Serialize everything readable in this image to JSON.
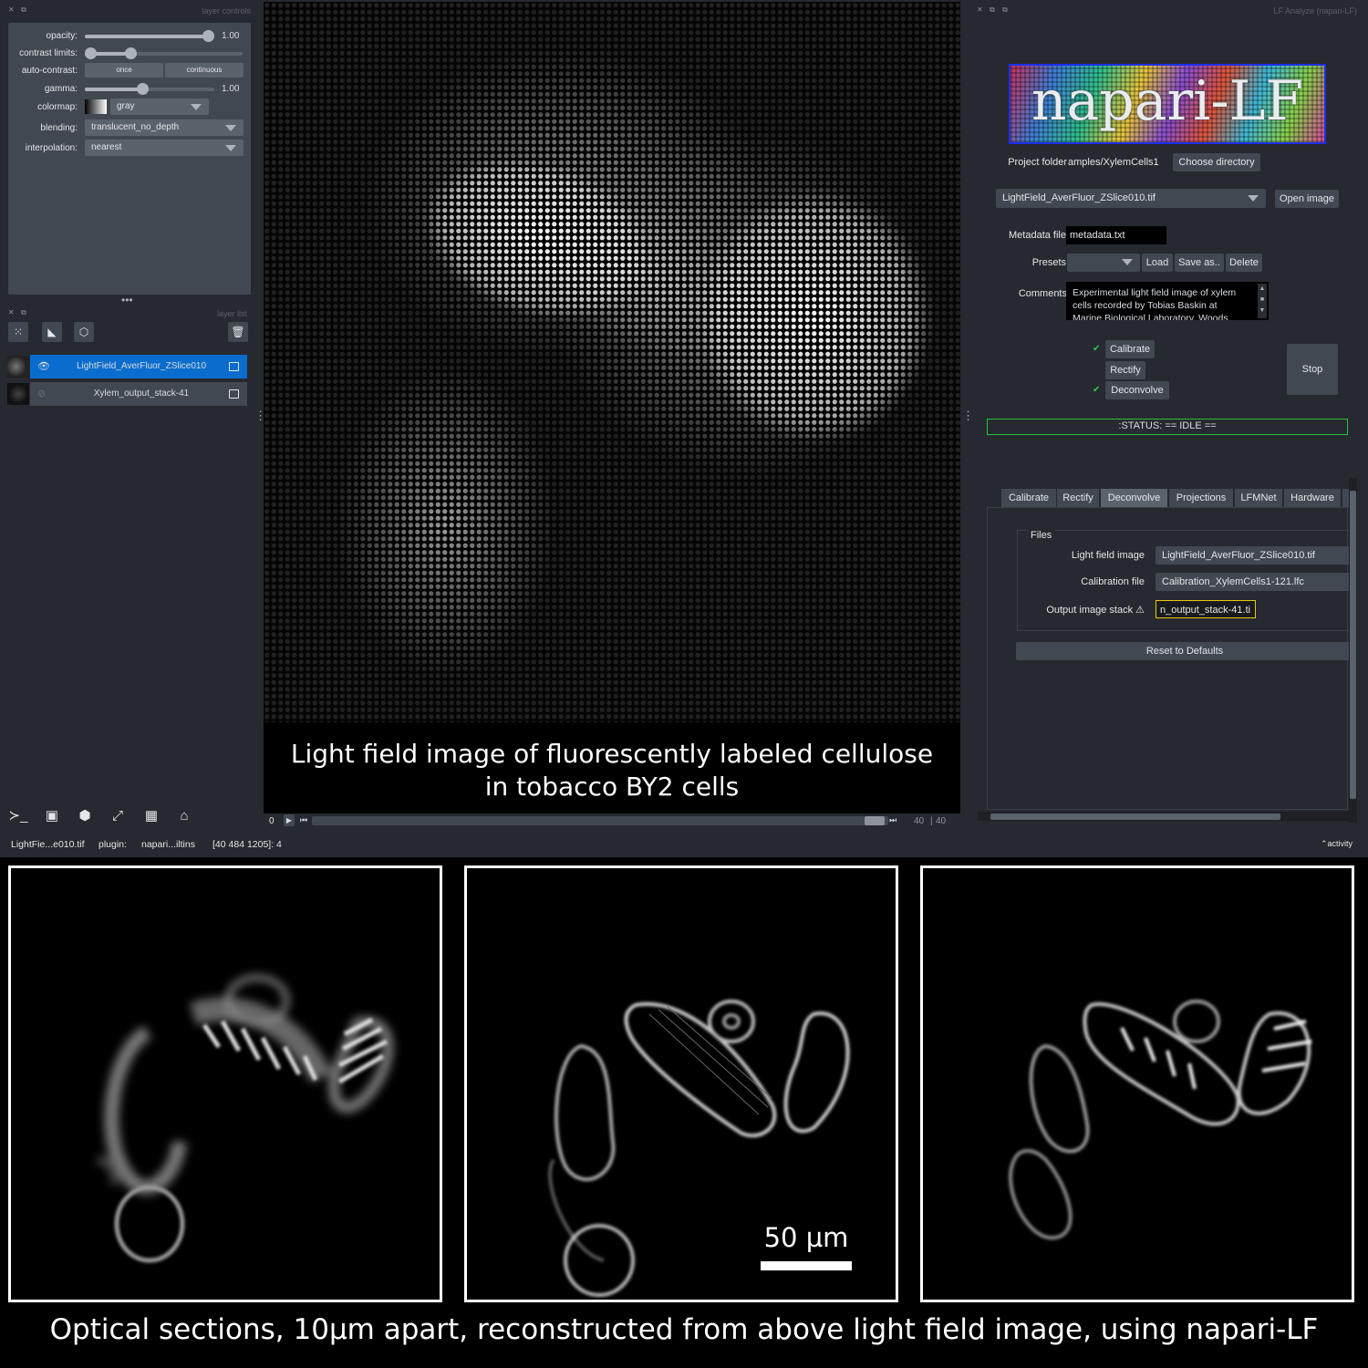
{
  "layer_controls": {
    "header": "layer controls",
    "opacity_label": "opacity:",
    "opacity_value": "1.00",
    "contrast_label": "contrast limits:",
    "autocontrast_label": "auto-contrast:",
    "once_label": "once",
    "continuous_label": "continuous",
    "gamma_label": "gamma:",
    "gamma_value": "1.00",
    "colormap_label": "colormap:",
    "colormap_value": "gray",
    "blending_label": "blending:",
    "blending_value": "translucent_no_depth",
    "interpolation_label": "interpolation:",
    "interpolation_value": "nearest"
  },
  "layer_list": {
    "header": "layer list",
    "layers": [
      {
        "name": "LightField_AverFluor_ZSlice010",
        "selected": true,
        "visible": true
      },
      {
        "name": "Xylem_output_stack-41",
        "selected": false,
        "visible": false
      }
    ]
  },
  "canvas": {
    "caption_line1": "Light field image of fluorescently labeled cellulose",
    "caption_line2": "in tobacco BY2 cells"
  },
  "dims": {
    "start": "0",
    "current": "40",
    "max": "40"
  },
  "status_bar": {
    "file": "LightFie...e010.tif",
    "plugin_label": "plugin:",
    "plugin_value": "napari...iltins",
    "coords": "[40 484 1205]: 4",
    "activity": "activity"
  },
  "lf_panel": {
    "header": "LF Analyze (napari-LF)",
    "logo_text": "napari-LF",
    "project_folder_label": "Project folder",
    "project_folder_value": "amples/XylemCells1",
    "choose_directory": "Choose directory",
    "image_select": "LightField_AverFluor_ZSlice010.tif",
    "open_image": "Open image",
    "metadata_label": "Metadata file",
    "metadata_value": "metadata.txt",
    "presets_label": "Presets",
    "load": "Load",
    "save_as": "Save as..",
    "delete": "Delete",
    "comments_label": "Comments",
    "comments_line1": "Experimental light field image of xylem",
    "comments_line2": "cells recorded by Tobias Baskin at",
    "comments_line3": "Marine Biological Laboratory, Woods",
    "calibrate": "Calibrate",
    "rectify": "Rectify",
    "deconvolve": "Deconvolve",
    "stop": "Stop",
    "status": ":STATUS: == IDLE ==",
    "tabs": [
      "Calibrate",
      "Rectify",
      "Deconvolve",
      "Projections",
      "LFMNet",
      "Hardware"
    ],
    "files_group": "Files",
    "lf_image_label": "Light field image",
    "lf_image_value": "LightField_AverFluor_ZSlice010.tif",
    "calib_label": "Calibration file",
    "calib_value": "Calibration_XylemCells1-121.lfc",
    "output_label": "Output image stack ⚠",
    "output_value": "n_output_stack-41.ti",
    "reset": "Reset to Defaults"
  },
  "figure": {
    "scalebar_label": "50 µm",
    "bottom_caption": "Optical sections, 10µm apart, reconstructed from above light field image, using napari-LF"
  },
  "colors": {
    "accent": "#0a6ccc",
    "status_border": "#25c23e",
    "output_border": "#e8c90f"
  },
  "icons": [
    "points-icon",
    "shapes-icon",
    "labels-icon",
    "delete-icon",
    "eye-icon",
    "eye-closed-icon",
    "console-icon",
    "2d-3d-icon",
    "roll-icon",
    "transpose-icon",
    "grid-icon",
    "home-icon"
  ]
}
